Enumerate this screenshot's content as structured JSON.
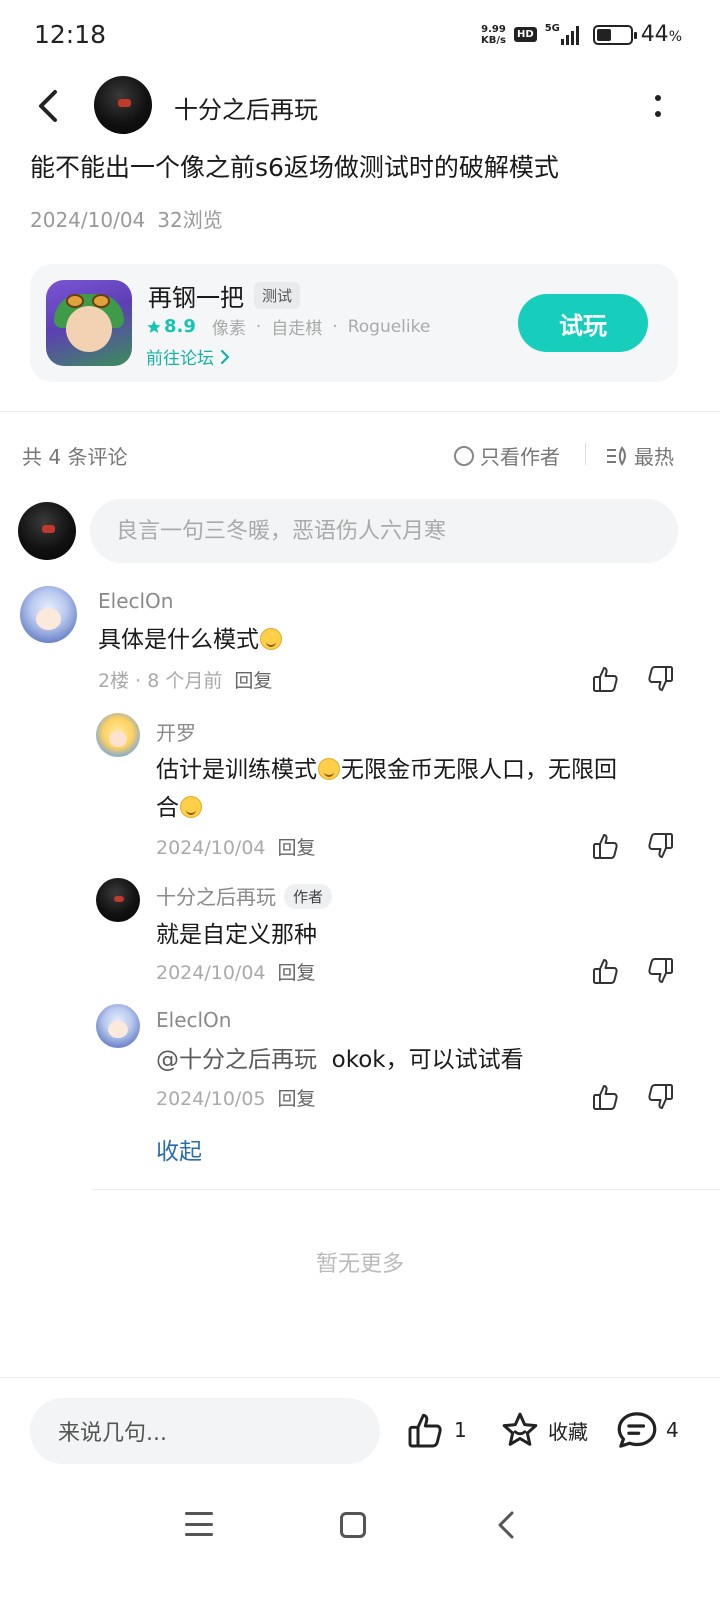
{
  "status_bar": {
    "time": "12:18",
    "net_speed_value": "9.99",
    "net_speed_unit": "KB/s",
    "hd": "HD",
    "network": "5G",
    "battery_percent": "44",
    "battery_percent_sign": "%",
    "battery_level": 0.44
  },
  "header": {
    "author_name": "十分之后再玩"
  },
  "post": {
    "title": "能不能出一个像之前s6返场做测试时的破解模式",
    "date": "2024/10/04",
    "views": "32浏览"
  },
  "game_card": {
    "name": "再钢一把",
    "badge": "测试",
    "rating": "8.9",
    "tags": [
      "像素",
      "自走棋",
      "Roguelike"
    ],
    "forum_link": "前往论坛",
    "play_button": "试玩"
  },
  "comments_bar": {
    "count_label": "共 4 条评论",
    "only_author": "只看作者",
    "sort_label": "最热"
  },
  "comment_input": {
    "placeholder": "良言一句三冬暖，恶语伤人六月寒"
  },
  "comments": [
    {
      "name": "EleclOn",
      "text": "具体是什么模式",
      "floor": "2楼",
      "time": "8 个月前",
      "reply": "回复"
    },
    {
      "name": "开罗",
      "text_a": "估计是训练模式",
      "text_b": "无限金币无限人口，无限回",
      "text_c": "合",
      "time": "2024/10/04",
      "reply": "回复"
    },
    {
      "name": "十分之后再玩",
      "badge": "作者",
      "text": "就是自定义那种",
      "time": "2024/10/04",
      "reply": "回复"
    },
    {
      "name": "EleclOn",
      "mention": "@十分之后再玩",
      "text": "okok，可以试试看",
      "time": "2024/10/05",
      "reply": "回复"
    }
  ],
  "collapse_label": "收起",
  "no_more_label": "暂无更多",
  "bottom_bar": {
    "input_placeholder": "来说几句...",
    "like_count": "1",
    "favorite_label": "收藏",
    "comment_count": "4"
  },
  "colors": {
    "accent": "#17cdbb",
    "link_blue": "#2b6cb0",
    "rating_green": "#15c5b3"
  }
}
